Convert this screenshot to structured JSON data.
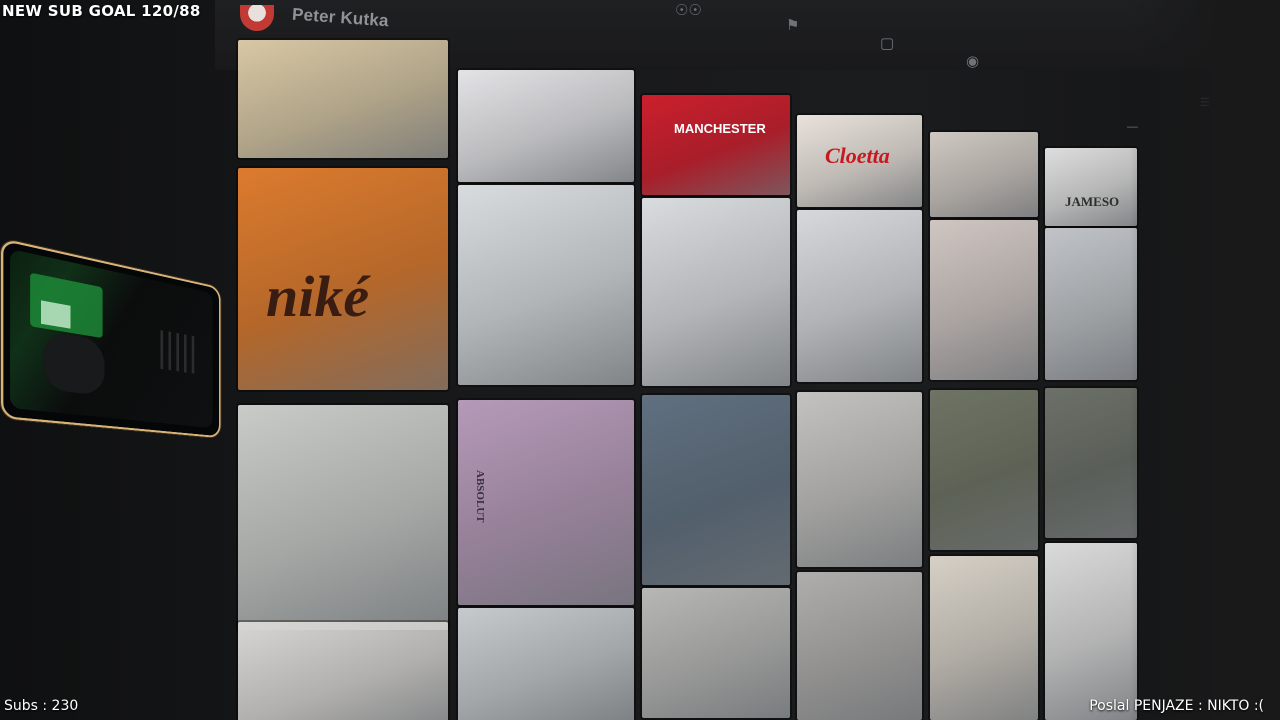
{
  "profile": {
    "name": "Peter Kutka"
  },
  "stream_overlay": {
    "sub_goal": "NEW SUB GOAL 120/88",
    "subs": "Subs : 230",
    "donation": "Poslal PENJAZE : NIKTO :("
  },
  "icons": {
    "friends": "people-icon",
    "flag": "flag-icon",
    "video": "video-icon",
    "settings": "gear-icon",
    "expand": "chevron-up-icon"
  },
  "photos": [
    {
      "label": "photo-yellow-figure",
      "color": "#d7c7a4"
    },
    {
      "label": "photo-sneakers",
      "color": "#e3e3e6"
    },
    {
      "label": "photo-manchester-shirt",
      "color": "#cc1f2d",
      "text": "MANCHESTER"
    },
    {
      "label": "photo-cloetta",
      "color": "#e9e2db",
      "text": "Cloetta"
    },
    {
      "label": "photo-figurine",
      "color": "#cfc8c2"
    },
    {
      "label": "photo-jameson",
      "color": "#dedede",
      "text": "JAMESO"
    },
    {
      "label": "photo-nike-orange",
      "color": "#dc7b2e",
      "text": "niké"
    },
    {
      "label": "photo-kick-snow",
      "color": "#d8dcdf"
    },
    {
      "label": "photo-snow-pose-red-hat",
      "color": "#d9dcde"
    },
    {
      "label": "photo-snow-arms-up",
      "color": "#d6d9dc"
    },
    {
      "label": "photo-red-shoe",
      "color": "#cfc6c2"
    },
    {
      "label": "photo-bottle-blue",
      "color": "#c0c4c8"
    },
    {
      "label": "photo-vodka-bottle",
      "color": "#c8cbc8"
    },
    {
      "label": "photo-absolut-vodka",
      "color": "#b59ab8",
      "text": "ABSOLUT"
    },
    {
      "label": "photo-red-jersey",
      "color": "#607080"
    },
    {
      "label": "photo-pavement",
      "color": "#c3c2bf"
    },
    {
      "label": "photo-yard",
      "color": "#6e7464"
    },
    {
      "label": "photo-church",
      "color": "#6b7068"
    },
    {
      "label": "photo-bottom-1",
      "color": "#d8d6d3"
    },
    {
      "label": "photo-bottom-2",
      "color": "#c6cacd"
    },
    {
      "label": "photo-bottom-3",
      "color": "#b7b8b6"
    },
    {
      "label": "photo-bottom-4",
      "color": "#b0aeac"
    },
    {
      "label": "photo-bottom-5",
      "color": "#d6d0c6"
    },
    {
      "label": "photo-red-sneaker",
      "color": "#dadada"
    }
  ]
}
